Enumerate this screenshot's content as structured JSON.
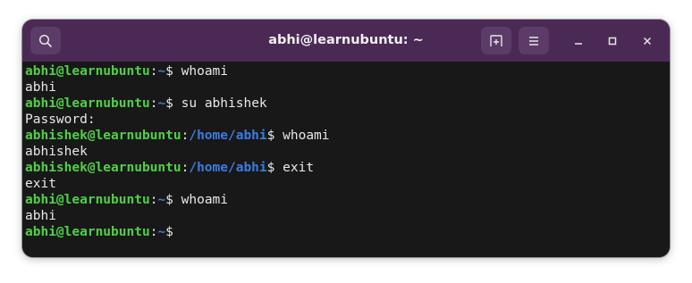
{
  "window": {
    "title": "abhi@learnubuntu: ~"
  },
  "titlebar": {
    "icons": [
      "search-icon",
      "new-tab-icon",
      "hamburger-menu-icon",
      "minimize-icon",
      "maximize-icon",
      "close-icon"
    ]
  },
  "colors": {
    "titlebar": "#4a2a55",
    "terminal_bg": "#181818",
    "prompt_user": "#4fd045",
    "prompt_path": "#3b7ce0",
    "text": "#e8e8e8"
  },
  "terminal": {
    "lines": [
      {
        "type": "prompt",
        "user": "abhi@learnubuntu",
        "sep": ":",
        "path": "~",
        "symbol": "$ ",
        "command": "whoami"
      },
      {
        "type": "output",
        "text": "abhi"
      },
      {
        "type": "prompt",
        "user": "abhi@learnubuntu",
        "sep": ":",
        "path": "~",
        "symbol": "$ ",
        "command": "su abhishek"
      },
      {
        "type": "output",
        "text": "Password:"
      },
      {
        "type": "prompt",
        "user": "abhishek@learnubuntu",
        "sep": ":",
        "path": "/home/abhi",
        "symbol": "$ ",
        "command": "whoami"
      },
      {
        "type": "output",
        "text": "abhishek"
      },
      {
        "type": "prompt",
        "user": "abhishek@learnubuntu",
        "sep": ":",
        "path": "/home/abhi",
        "symbol": "$ ",
        "command": "exit"
      },
      {
        "type": "output",
        "text": "exit"
      },
      {
        "type": "prompt",
        "user": "abhi@learnubuntu",
        "sep": ":",
        "path": "~",
        "symbol": "$ ",
        "command": "whoami"
      },
      {
        "type": "output",
        "text": "abhi"
      },
      {
        "type": "prompt",
        "user": "abhi@learnubuntu",
        "sep": ":",
        "path": "~",
        "symbol": "$",
        "command": ""
      }
    ]
  }
}
